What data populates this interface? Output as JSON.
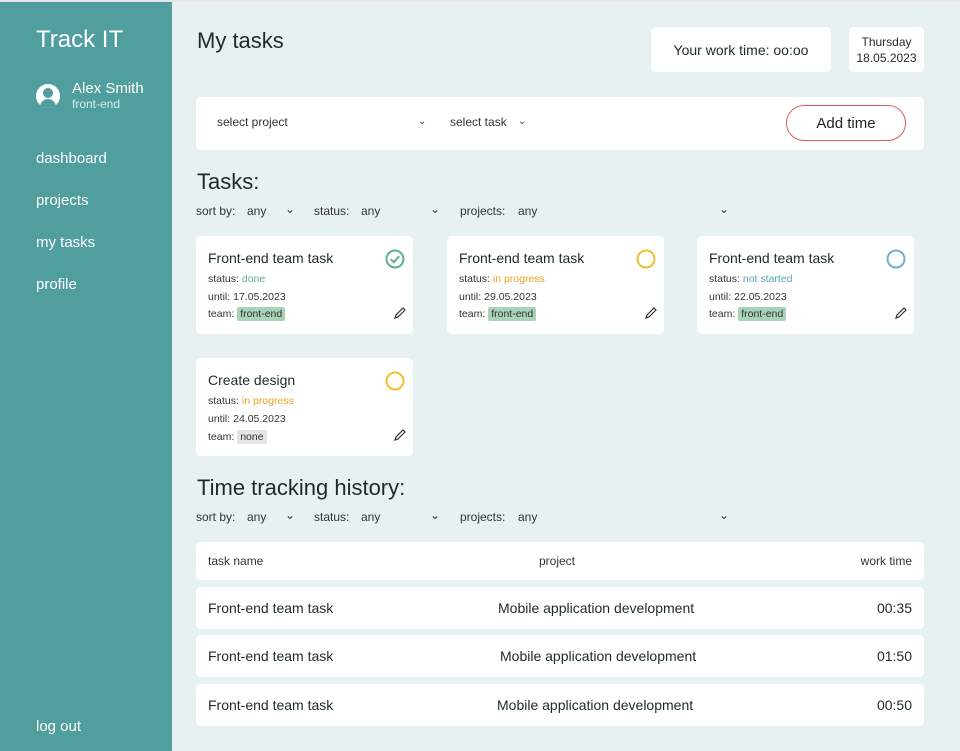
{
  "sidebar": {
    "brand": "Track IT",
    "user_name": "Alex Smith",
    "user_role": "front-end",
    "nav": [
      "dashboard",
      "projects",
      "my tasks",
      "profile"
    ],
    "logout": "log out",
    "bg_color": "#519e9e"
  },
  "header": {
    "title": "My tasks",
    "work_time": "Your work time: oo:oo",
    "day": "Thursday",
    "date": "18.05.2023"
  },
  "toolbar": {
    "select_project": "select project",
    "select_task": "select task",
    "add_time": "Add time"
  },
  "tasks_section": {
    "title": "Tasks:",
    "filters": {
      "sort_label": "sort by:",
      "sort_value": "any",
      "status_label": "status:",
      "status_value": "any",
      "projects_label": "projects:",
      "projects_value": "any"
    },
    "cards": [
      {
        "title": "Front-end team task",
        "status_label": "status:",
        "status": "done",
        "until_label": "until:",
        "until": "17.05.2023",
        "team_label": "team:",
        "team": "front-end",
        "icon": "check-circle-icon",
        "color": "#5bb08d"
      },
      {
        "title": "Front-end team task",
        "status_label": "status:",
        "status": "in progress",
        "until_label": "until:",
        "until": "29.05.2023",
        "team_label": "team:",
        "team": "front-end",
        "icon": "circle-icon",
        "color": "#f0c030"
      },
      {
        "title": "Front-end team task",
        "status_label": "status:",
        "status": "not started",
        "until_label": "until:",
        "until": "22.05.2023",
        "team_label": "team:",
        "team": "front-end",
        "icon": "circle-icon",
        "color": "#6ab4c4"
      },
      {
        "title": "Create design",
        "status_label": "status:",
        "status": "in progress",
        "until_label": "until:",
        "until": "24.05.2023",
        "team_label": "team:",
        "team": "none",
        "icon": "circle-icon",
        "color": "#f0c030"
      }
    ]
  },
  "history_section": {
    "title": "Time tracking history:",
    "filters": {
      "sort_label": "sort by:",
      "sort_value": "any",
      "status_label": "status:",
      "status_value": "any",
      "projects_label": "projects:",
      "projects_value": "any"
    },
    "columns": [
      "task name",
      "project",
      "work time"
    ],
    "rows": [
      {
        "task": "Front-end team task",
        "project": "Mobile application development",
        "time": "00:35"
      },
      {
        "task": "Front-end team task",
        "project": "Mobile application development",
        "time": "01:50"
      },
      {
        "task": "Front-end team task",
        "project": "Mobile application development",
        "time": "00:50"
      }
    ]
  }
}
